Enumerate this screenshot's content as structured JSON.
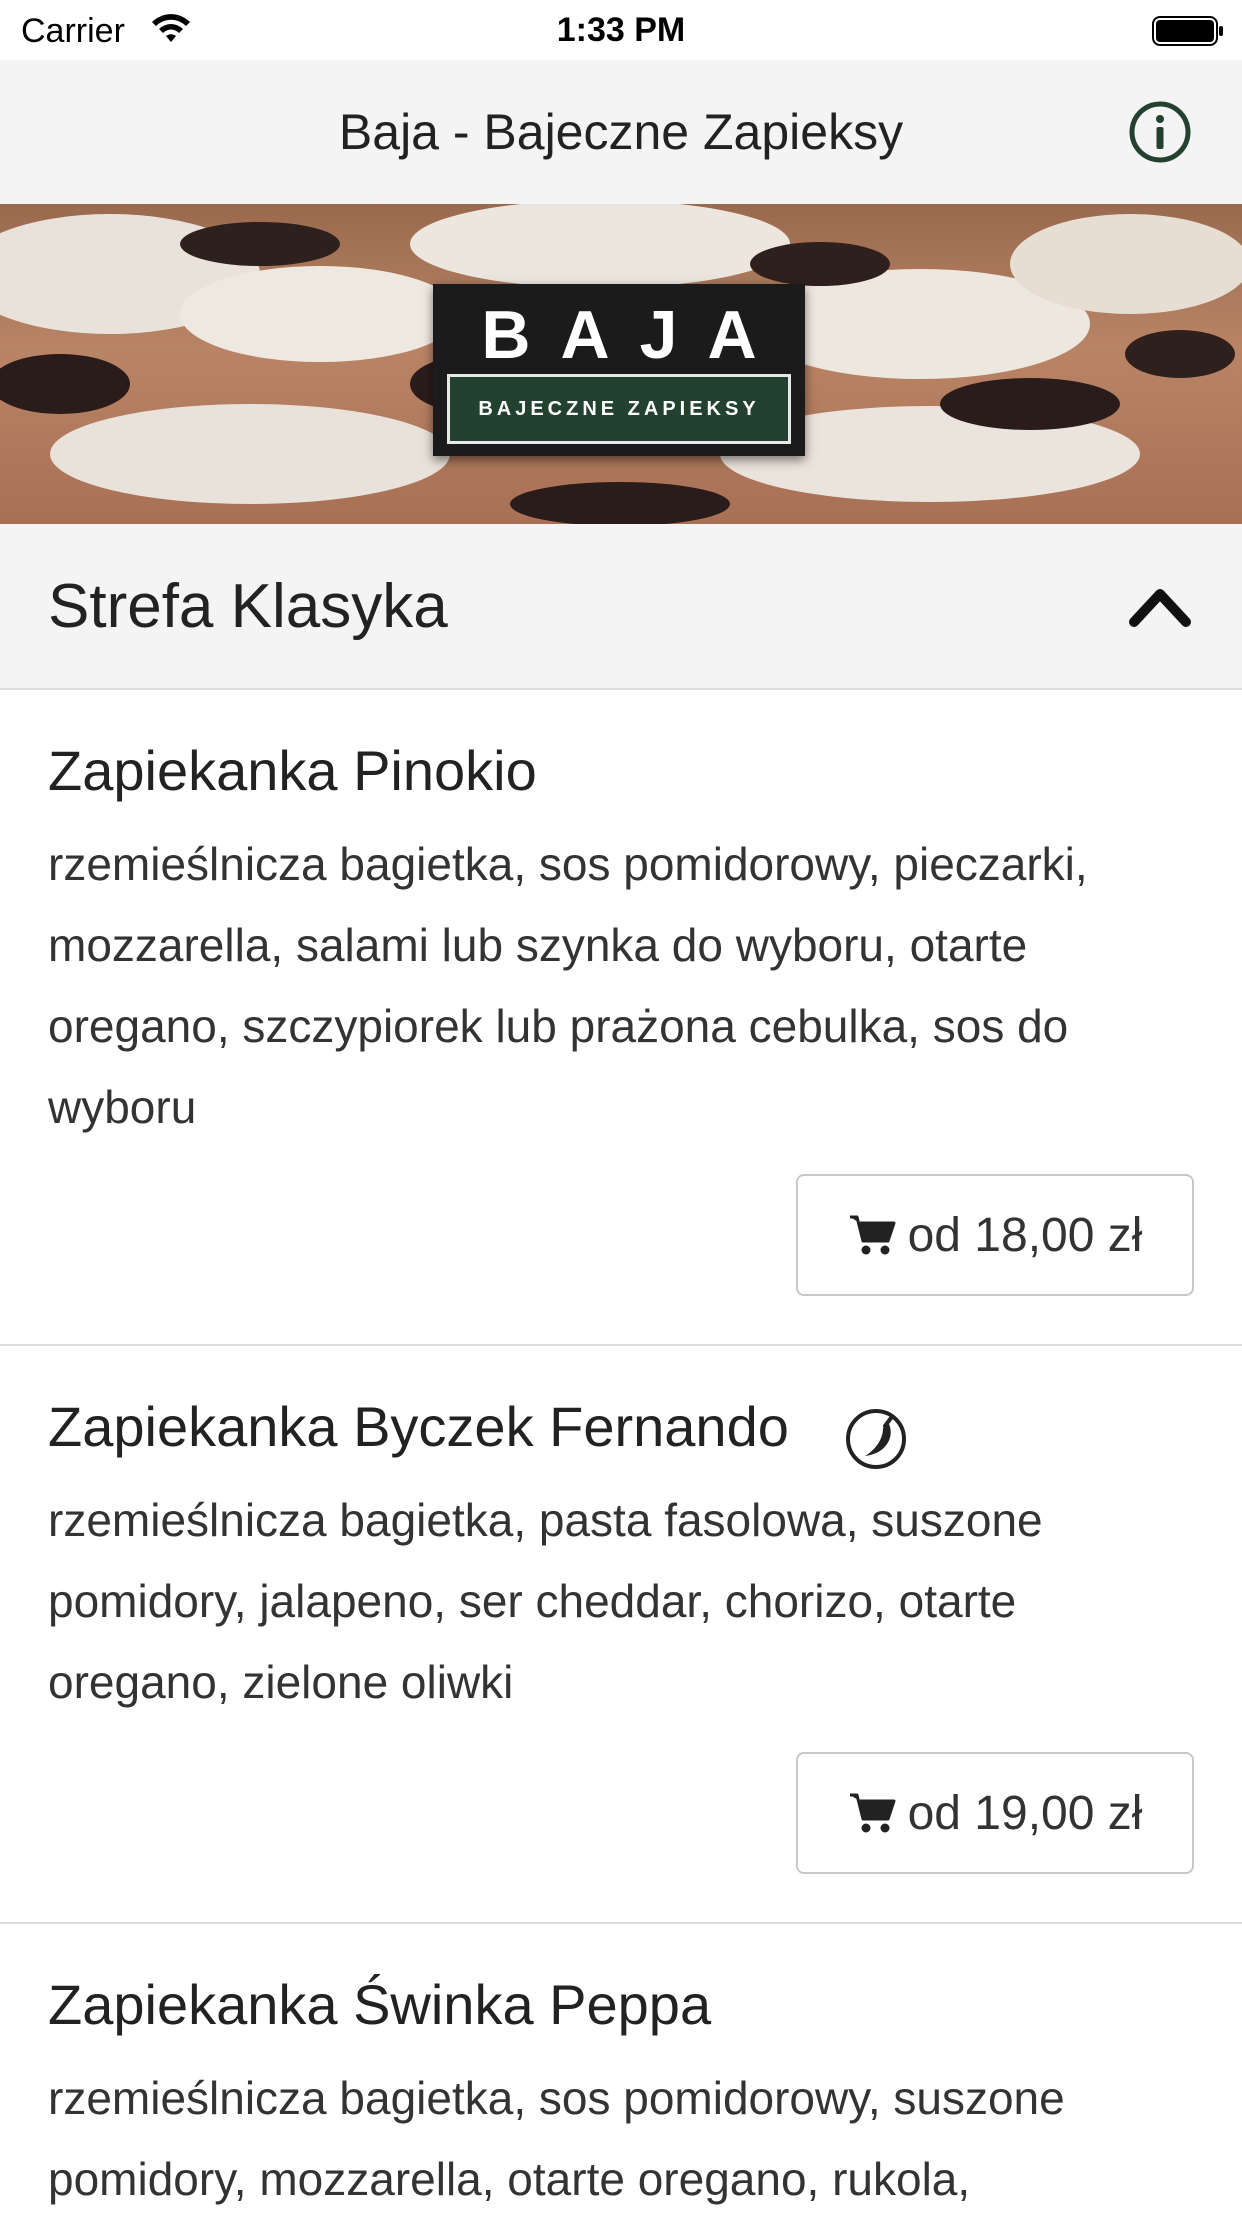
{
  "status_bar": {
    "carrier": "Carrier",
    "time": "1:33 PM"
  },
  "nav": {
    "title": "Baja - Bajeczne Zapieksy",
    "info_icon": "info-icon"
  },
  "banner": {
    "logo_top": "BAJA",
    "logo_bottom": "BAJECZNE ZAPIEKSY"
  },
  "category": {
    "title": "Strefa Klasyka",
    "expanded": true
  },
  "items": [
    {
      "name": "Zapiekanka Pinokio",
      "description": "rzemieślnicza bagietka, sos pomidorowy, pieczarki, mozzarella, salami lub szynka do wyboru, otarte oregano, szczypiorek lub prażona cebulka, sos do wyboru",
      "price": "od 18,00 zł",
      "spicy": false
    },
    {
      "name": "Zapiekanka Byczek Fernando",
      "description": "rzemieślnicza bagietka, pasta fasolowa, suszone pomidory, jalapeno, ser cheddar, chorizo, otarte oregano, zielone oliwki",
      "price": "od 19,00 zł",
      "spicy": true
    },
    {
      "name": "Zapiekanka Świnka Peppa",
      "description": "rzemieślnicza bagietka, sos pomidorowy, suszone pomidory, mozzarella, otarte oregano, rukola,",
      "spicy": false
    }
  ],
  "colors": {
    "nav_background": "#f4f4f4",
    "brand_green": "#23412f",
    "text": "#222222",
    "divider": "#dedede"
  }
}
